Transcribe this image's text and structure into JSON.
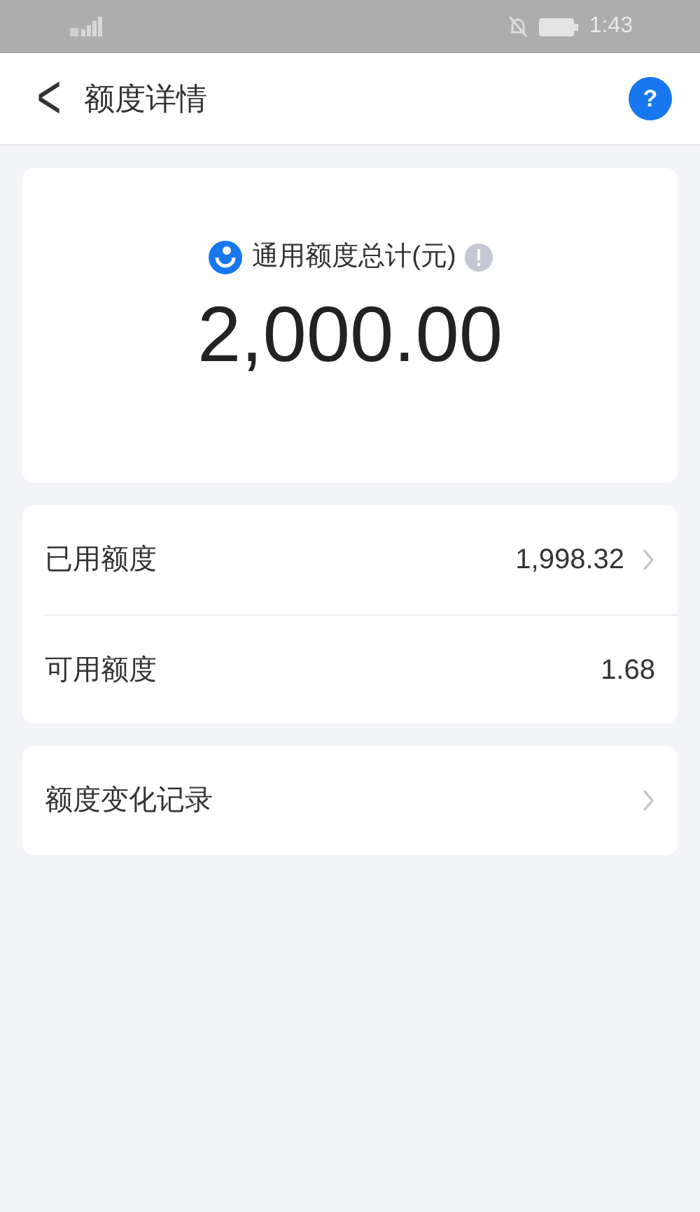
{
  "status_bar": {
    "time": "1:43"
  },
  "header": {
    "title": "额度详情",
    "back": "<",
    "help": "?"
  },
  "summary": {
    "label": "通用额度总计(元)",
    "amount": "2,000.00"
  },
  "rows": [
    {
      "label": "已用额度",
      "value": "1,998.32",
      "chevron": true
    },
    {
      "label": "可用额度",
      "value": "1.68",
      "chevron": false
    }
  ],
  "history": {
    "label": "额度变化记录",
    "chevron": true
  }
}
